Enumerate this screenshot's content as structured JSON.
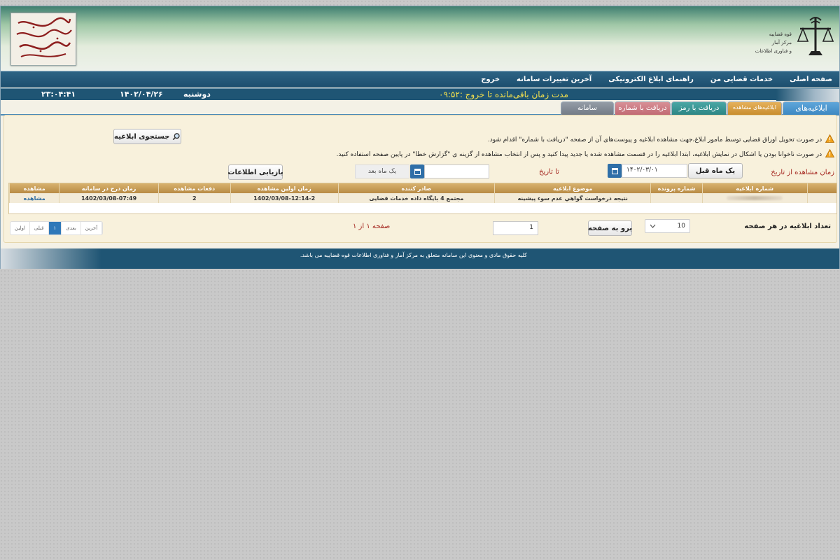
{
  "banner": {
    "logo_text_line1": "الکترونیک قضایی",
    "logo_text_line2": "سامانه ابلاغ",
    "org_line1": "قوه قضاییه",
    "org_line2": "مرکز آمار",
    "org_line3": "و فناوری اطلاعات"
  },
  "nav": {
    "items": [
      "صفحه اصلی",
      "خدمات قضایی من",
      "راهنمای ابلاغ الکترونیکی",
      "آخرین تغییرات سامانه",
      "خروج"
    ]
  },
  "status": {
    "day": "دوشنبه",
    "date": "۱۴۰۲/۰۴/۲۶",
    "time": "۲۳:۰۴:۴۱",
    "timer_label": "مدت زمان باقی‌مانده تا خروج :۰۹:۵۲"
  },
  "tabs": [
    "ابلاغیه‌های",
    "ابلاغیه‌های مشاهده",
    "دریافت با رمز",
    "دریافت با شماره",
    "سامانه"
  ],
  "notices": [
    "در صورت تحویل اوراق قضایی توسط مامور ابلاغ،جهت مشاهده ابلاغیه و پیوست‌های آن از صفحه \"دریافت با شماره\" اقدام شود.",
    "در صورت ناخوانا بودن یا اشکال در نمایش ابلاغیه، ابتدا ابلاغیه را در قسمت مشاهده شده یا جدید پیدا کنید و پس از انتخاب مشاهده از گزینه ی \"گزارش خطا\" در پایین صفحه استفاده کنید."
  ],
  "search_button": "جستجوی ابلاغیه",
  "filter": {
    "from_label": "زمان مشاهده از تاریخ",
    "prev_month": "یک ماه قبل",
    "from_value": "۱۴۰۲/۰۳/۰۱",
    "to_label": "تا تاریخ",
    "to_value": "",
    "next_month": "یک ماه بعد",
    "refresh": "بازیابی اطلاعات"
  },
  "table": {
    "headers": [
      "شماره ابلاغیه",
      "شماره پرونده",
      "موضوع ابلاغیه",
      "صادر کننده",
      "زمان اولین مشاهده",
      "دفعات مشاهده",
      "زمان درج در سامانه",
      "مشاهده"
    ],
    "rows": [
      {
        "number": "",
        "case": "",
        "subject": "نتیجه درخواست گواهي عدم سوء پیشینه",
        "issuer": "مجتمع 4 بایگاه داده خدمات قضایی",
        "first_view": "1402/03/08-12:14-2",
        "view_count": "2",
        "insert_time": "1402/03/08-07:49",
        "view": "مشاهده"
      }
    ]
  },
  "pager": {
    "per_page_label": "تعداد ابلاغیه در هر صفحه",
    "per_page_value": "10",
    "goto_button": "برو به صفحه",
    "page_input": "1",
    "page_info": "صفحه ۱ از ۱",
    "first": "اولین",
    "prev": "قبلی",
    "current": "۱",
    "next": "بعدی",
    "last": "آخرین"
  },
  "footer": {
    "text": "کلیه حقوق مادی و معنوی این سامانه متعلق به مرکز آمار و فناوری اطلاعات قوه قضاییه می باشد."
  },
  "colors": {
    "nav": "#1c4e6e",
    "accent_blue": "#3d88c2",
    "table_header": "#c49a52",
    "label_red": "#a4251e",
    "timer_yellow": "#f4e04d"
  }
}
